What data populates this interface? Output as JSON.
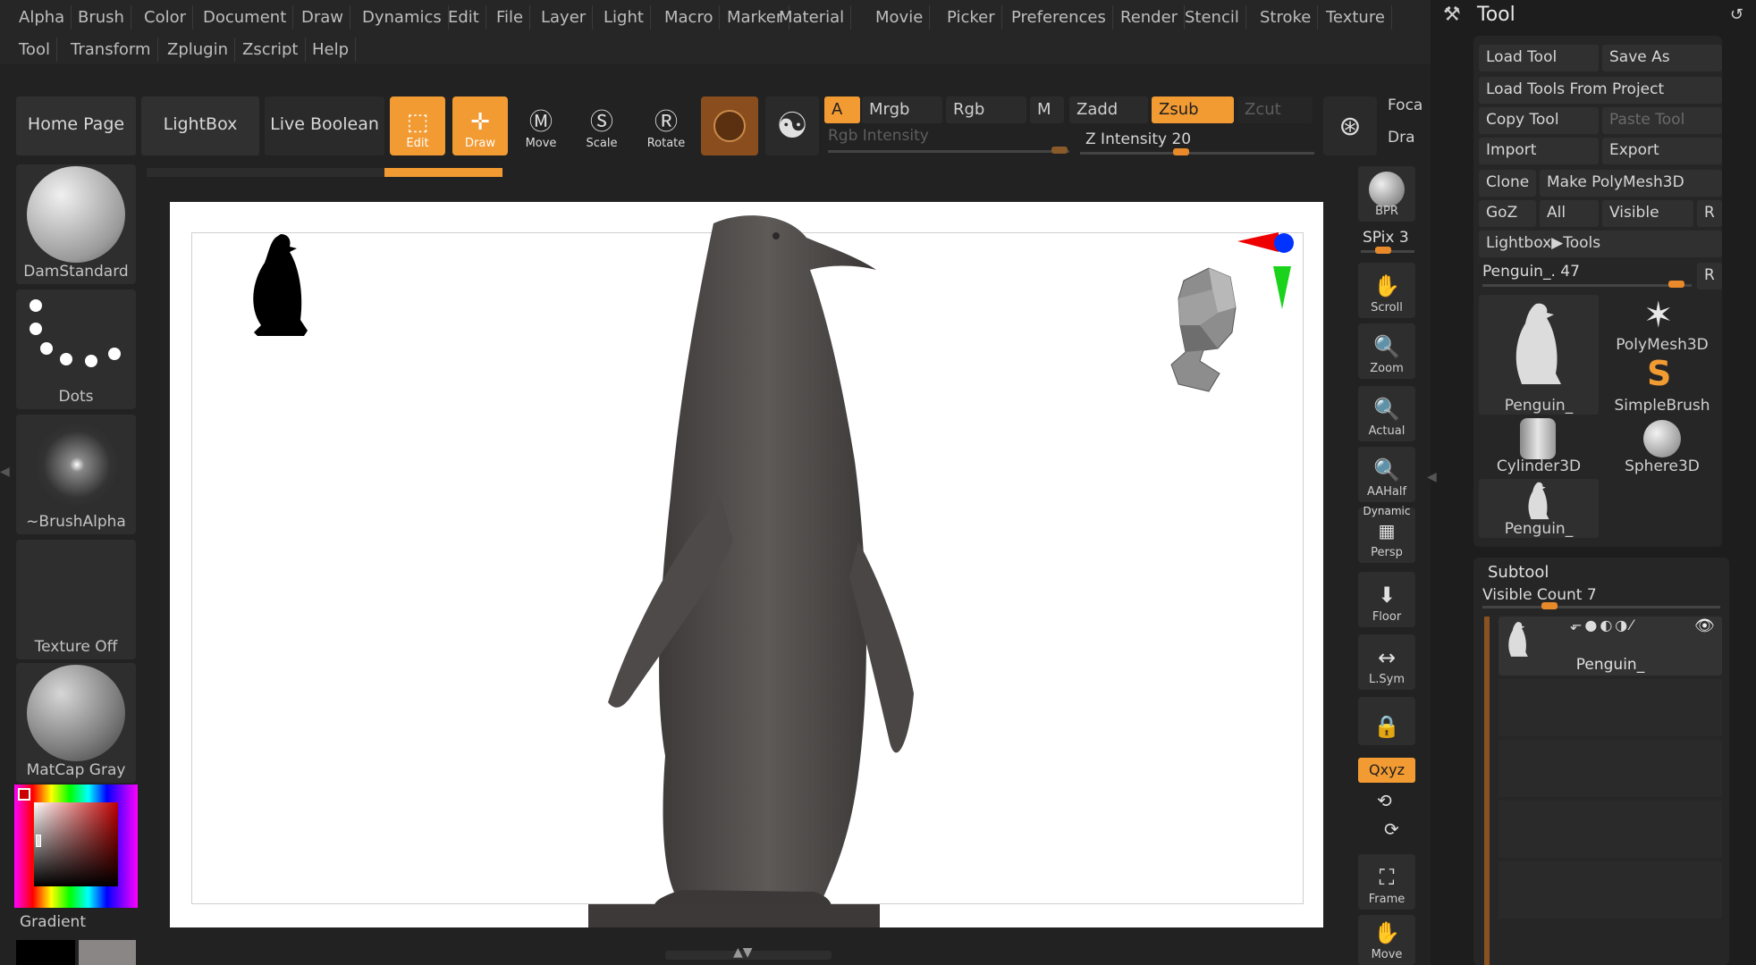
{
  "menu": {
    "row1": [
      "Alpha",
      "Brush",
      "Color",
      "Document",
      "Draw",
      "Dynamics",
      "Edit",
      "File",
      "Layer",
      "Light",
      "Macro",
      "Marker",
      "Material",
      "Movie",
      "Picker",
      "Preferences",
      "Render",
      "Stencil",
      "Stroke",
      "Texture"
    ],
    "row2": [
      "Tool",
      "Transform",
      "Zplugin",
      "Zscript",
      "Help"
    ]
  },
  "top_shelf": {
    "home_page": "Home Page",
    "lightbox": "LightBox",
    "live_boolean": "Live Boolean",
    "edit": "Edit",
    "draw": "Draw",
    "move": "Move",
    "scale": "Scale",
    "rotate": "Rotate",
    "a": "A",
    "mrgb": "Mrgb",
    "rgb": "Rgb",
    "m": "M",
    "zadd": "Zadd",
    "zsub": "Zsub",
    "zcut": "Zcut",
    "rgb_intensity": "Rgb Intensity",
    "z_intensity": "Z Intensity 20",
    "z_intensity_value": 20,
    "focal": "Foca",
    "draw_size": "Dra"
  },
  "left_shelf": {
    "brush": "DamStandard",
    "stroke": "Dots",
    "alpha": "~BrushAlpha",
    "texture": "Texture Off",
    "material": "MatCap Gray",
    "gradient": "Gradient"
  },
  "right_shelf": {
    "bpr": "BPR",
    "spix": "SPix 3",
    "scroll": "Scroll",
    "zoom": "Zoom",
    "actual": "Actual",
    "aahalf": "AAHalf",
    "dynamic": "Dynamic",
    "persp": "Persp",
    "floor": "Floor",
    "lsym": "L.Sym",
    "xyz": "Qxyz",
    "frame": "Frame",
    "move": "Move"
  },
  "tool_panel": {
    "title": "Tool",
    "load_tool": "Load Tool",
    "save_as": "Save As",
    "load_from_project": "Load Tools From Project",
    "copy_tool": "Copy Tool",
    "paste_tool": "Paste Tool",
    "import": "Import",
    "export": "Export",
    "clone": "Clone",
    "make_polymesh": "Make PolyMesh3D",
    "goz": "GoZ",
    "all": "All",
    "visible": "Visible",
    "r": "R",
    "lightbox_tools": "Lightbox▶Tools",
    "current_tool": "Penguin_. 47",
    "current_tool_value": 47,
    "thumbs": [
      "Penguin_",
      "PolyMesh3D",
      "SimpleBrush",
      "Cylinder3D",
      "Sphere3D",
      "Penguin_"
    ]
  },
  "subtool": {
    "title": "Subtool",
    "visible_count": "Visible Count 7",
    "item": "Penguin_"
  },
  "colors": {
    "accent": "#f29b33",
    "panel": "#2e2e2e",
    "bg": "#222222"
  }
}
